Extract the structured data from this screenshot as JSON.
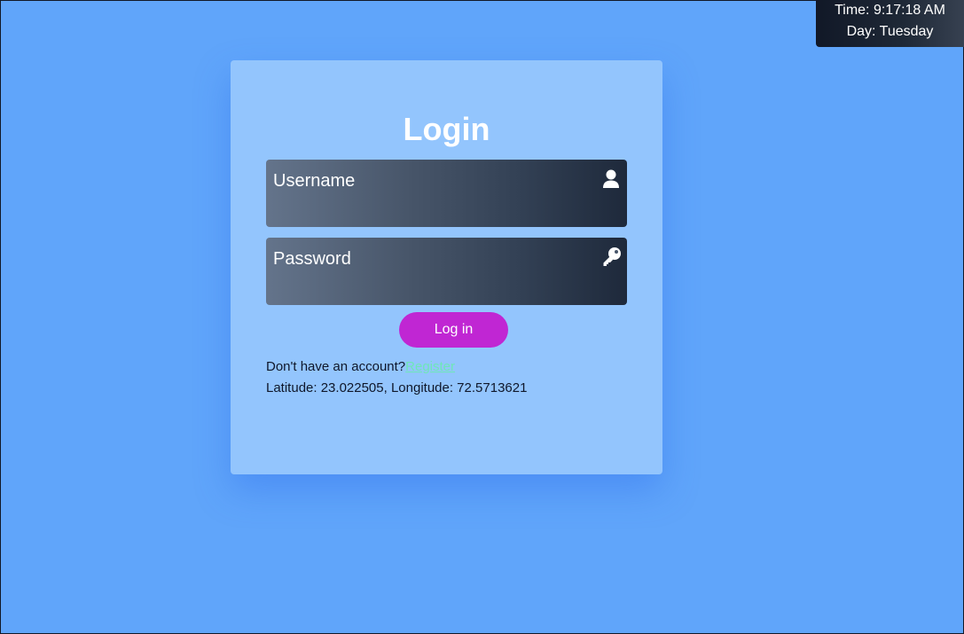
{
  "clock": {
    "time": "Time: 9:17:18 AM",
    "day": "Day: Tuesday"
  },
  "login_card": {
    "title": "Login",
    "username_placeholder": "Username",
    "password_placeholder": "Password",
    "username_icon": "user-icon",
    "password_icon": "key-icon",
    "submit_label": "Log in",
    "register_prompt": "Don't have an account?",
    "register_link": "Register",
    "location_text": "Latitude: 23.022505, Longitude: 72.5713621"
  },
  "colors": {
    "page_background": "#60a5fa",
    "card_background": "#93c5fd",
    "button_background": "#c026d3",
    "register_link": "#6ee7b7"
  }
}
